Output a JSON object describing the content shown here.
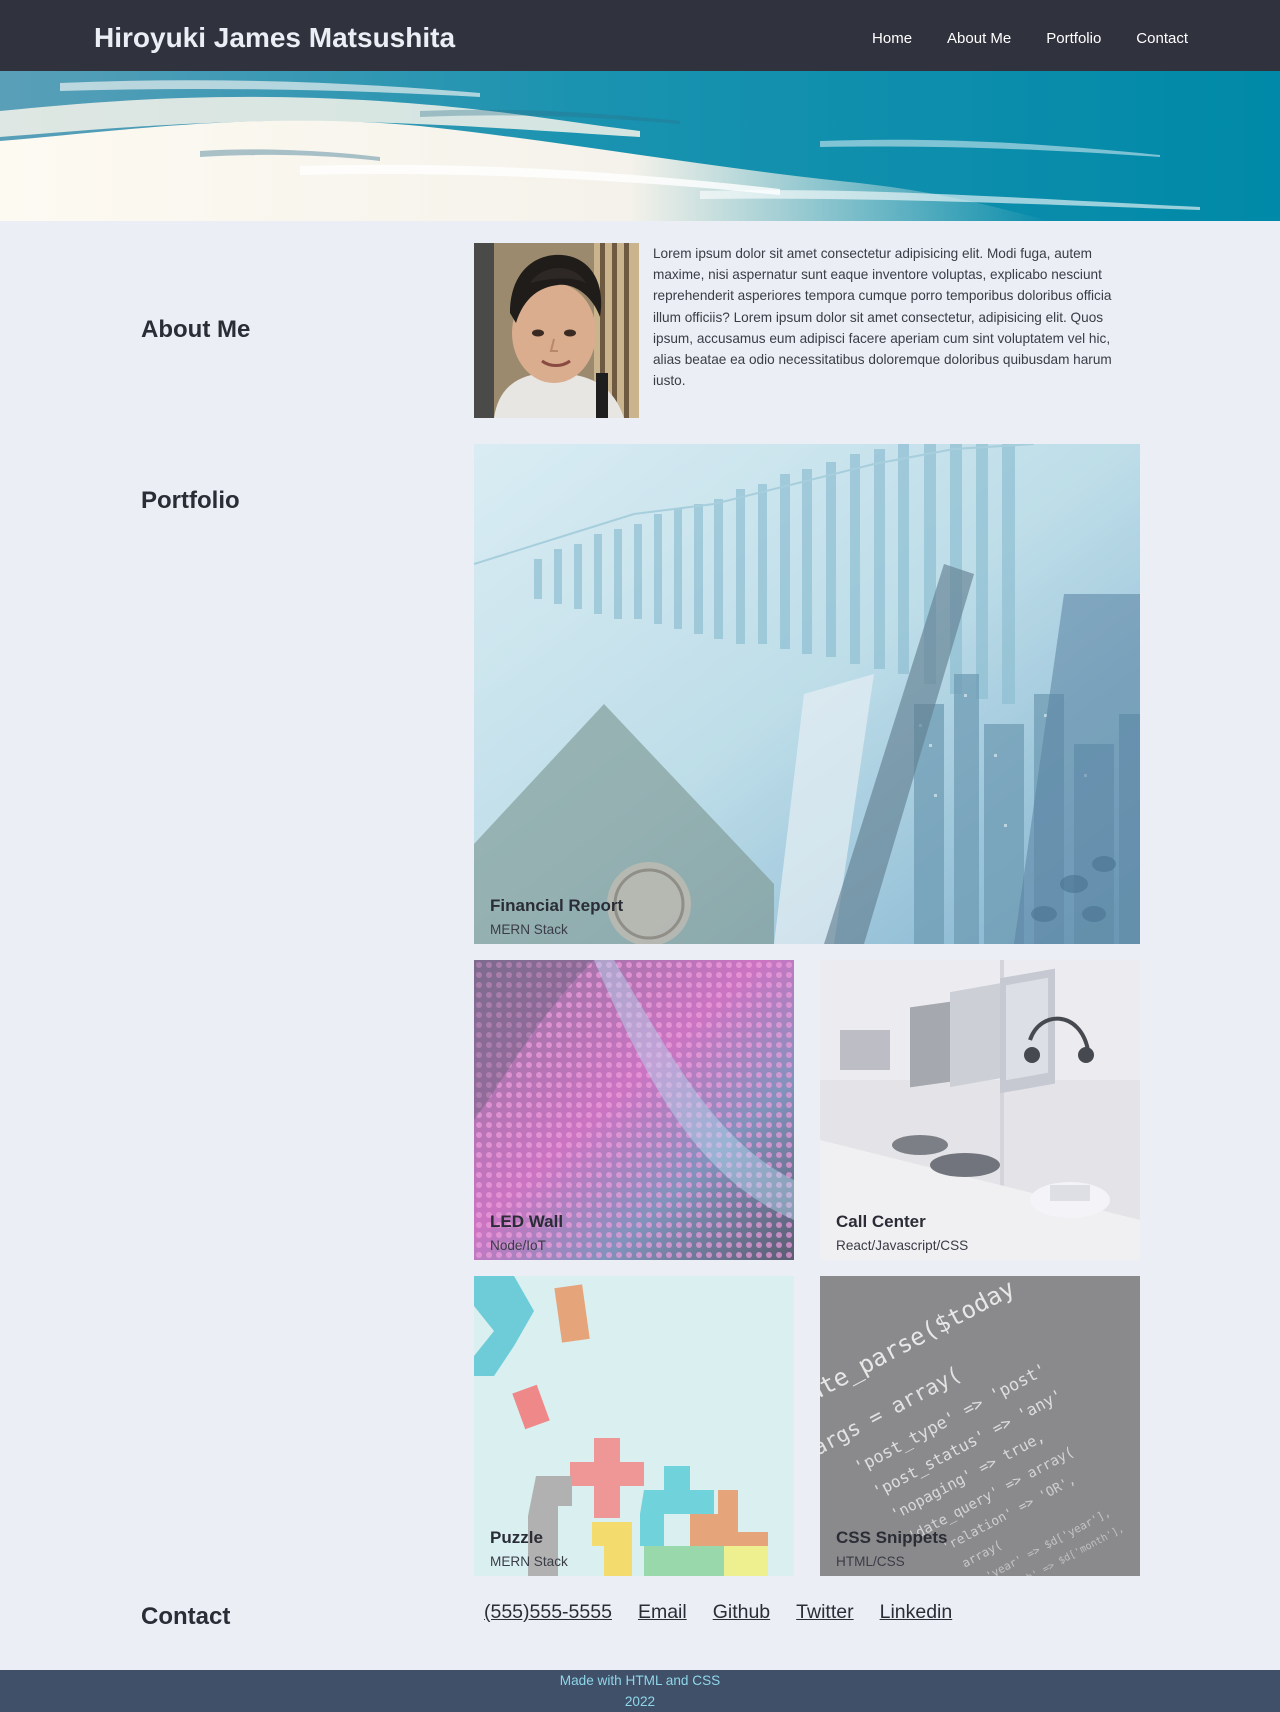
{
  "header": {
    "site_title": "Hiroyuki James Matsushita",
    "nav": [
      "Home",
      "About Me",
      "Portfolio",
      "Contact"
    ]
  },
  "about": {
    "heading": "About Me",
    "text": "Lorem ipsum dolor sit amet consectetur adipisicing elit. Modi fuga, autem maxime, nisi aspernatur sunt eaque inventore voluptas, explicabo nesciunt reprehenderit asperiores tempora cumque porro temporibus doloribus officia illum officiis? Lorem ipsum dolor sit amet consectetur, adipisicing elit. Quos ipsum, accusamus eum adipisci facere aperiam cum sint voluptatem vel hic, alias beatae ea odio necessitatibus doloremque doloribus quibusdam harum iusto."
  },
  "portfolio": {
    "heading": "Portfolio",
    "projects": [
      {
        "title": "Financial Report",
        "stack": "MERN Stack"
      },
      {
        "title": "LED Wall",
        "stack": "Node/IoT"
      },
      {
        "title": "Call Center",
        "stack": "React/Javascript/CSS"
      },
      {
        "title": "Puzzle",
        "stack": "MERN Stack"
      },
      {
        "title": "CSS Snippets",
        "stack": "HTML/CSS"
      }
    ]
  },
  "contact": {
    "heading": "Contact",
    "links": [
      "(555)555-5555",
      "Email",
      "Github",
      "Twitter",
      "Linkedin"
    ]
  },
  "footer": {
    "line1": "Made with HTML and CSS",
    "line2": "2022"
  },
  "colors": {
    "header_bg": "#30323d",
    "page_bg": "#eceef5",
    "hero_blue": "#0a8eab",
    "footer_bg": "#3f5068",
    "footer_text": "#8fd6ea"
  }
}
